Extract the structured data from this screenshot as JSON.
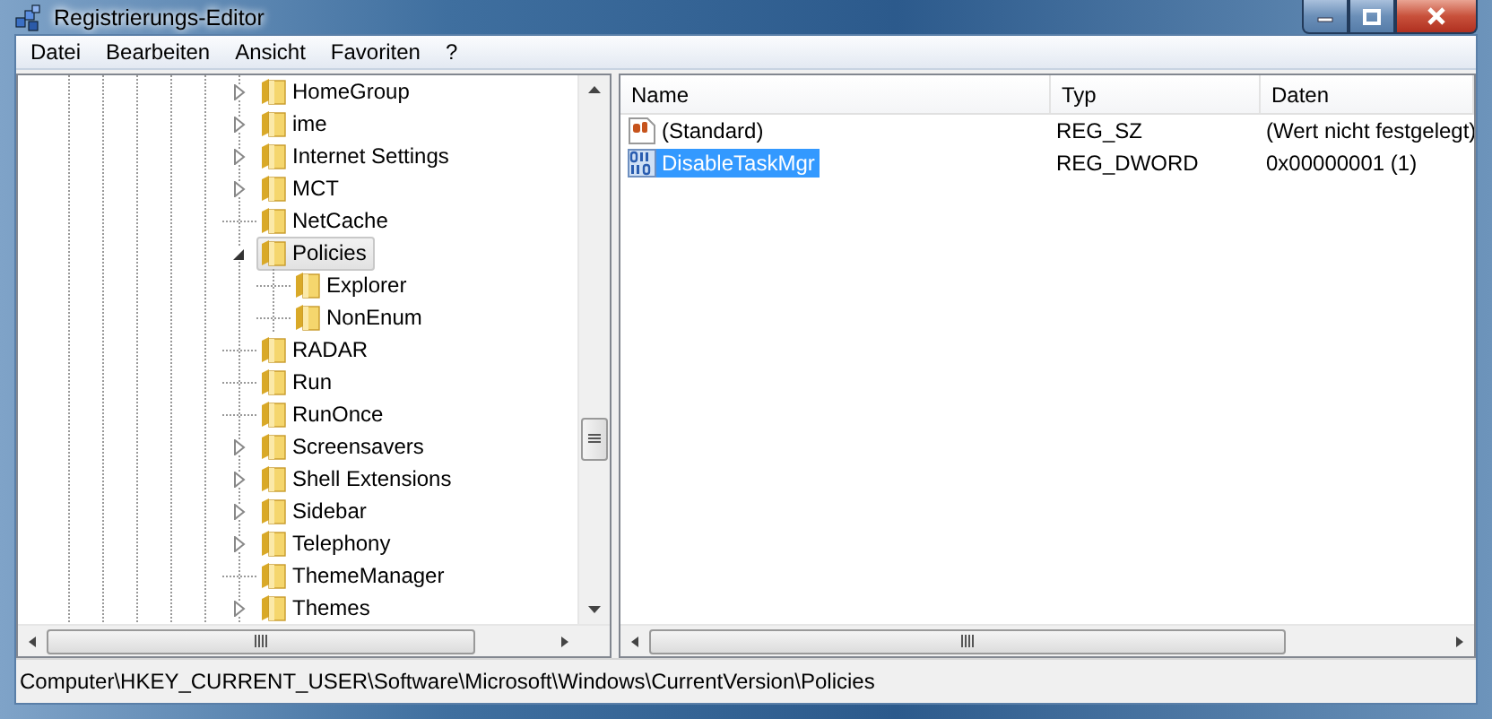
{
  "window": {
    "title": "Registrierungs-Editor"
  },
  "menu": [
    "Datei",
    "Bearbeiten",
    "Ansicht",
    "Favoriten",
    "?"
  ],
  "tree": [
    {
      "label": "HomeGroup",
      "expandable": true,
      "expanded": false,
      "selected": false
    },
    {
      "label": "ime",
      "expandable": true,
      "expanded": false,
      "selected": false
    },
    {
      "label": "Internet Settings",
      "expandable": true,
      "expanded": false,
      "selected": false
    },
    {
      "label": "MCT",
      "expandable": true,
      "expanded": false,
      "selected": false
    },
    {
      "label": "NetCache",
      "expandable": false,
      "expanded": false,
      "selected": false
    },
    {
      "label": "Policies",
      "expandable": true,
      "expanded": true,
      "selected": true,
      "children": [
        {
          "label": "Explorer",
          "expandable": false,
          "expanded": false,
          "selected": false
        },
        {
          "label": "NonEnum",
          "expandable": false,
          "expanded": false,
          "selected": false
        }
      ]
    },
    {
      "label": "RADAR",
      "expandable": false,
      "expanded": false,
      "selected": false
    },
    {
      "label": "Run",
      "expandable": false,
      "expanded": false,
      "selected": false
    },
    {
      "label": "RunOnce",
      "expandable": false,
      "expanded": false,
      "selected": false
    },
    {
      "label": "Screensavers",
      "expandable": true,
      "expanded": false,
      "selected": false
    },
    {
      "label": "Shell Extensions",
      "expandable": true,
      "expanded": false,
      "selected": false
    },
    {
      "label": "Sidebar",
      "expandable": true,
      "expanded": false,
      "selected": false
    },
    {
      "label": "Telephony",
      "expandable": true,
      "expanded": false,
      "selected": false
    },
    {
      "label": "ThemeManager",
      "expandable": false,
      "expanded": false,
      "selected": false
    },
    {
      "label": "Themes",
      "expandable": true,
      "expanded": false,
      "selected": false
    }
  ],
  "values": {
    "columns": [
      "Name",
      "Typ",
      "Daten"
    ],
    "rows": [
      {
        "kind": "string",
        "name": "(Standard)",
        "type": "REG_SZ",
        "data": "(Wert nicht festgelegt)",
        "selected": false
      },
      {
        "kind": "binary",
        "name": "DisableTaskMgr",
        "type": "REG_DWORD",
        "data": "0x00000001 (1)",
        "selected": true
      }
    ]
  },
  "status_bar": "Computer\\HKEY_CURRENT_USER\\Software\\Microsoft\\Windows\\CurrentVersion\\Policies"
}
